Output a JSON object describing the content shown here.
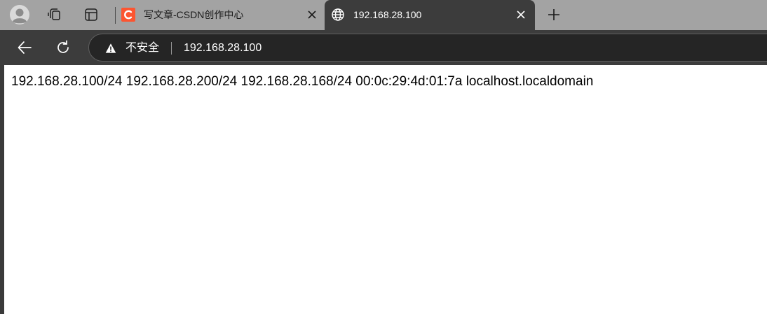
{
  "tabs": [
    {
      "title": "写文章-CSDN创作中心",
      "icon": "csdn-logo-icon",
      "active": false
    },
    {
      "title": "192.168.28.100",
      "icon": "globe-icon",
      "active": true
    }
  ],
  "address_bar": {
    "security_label": "不安全",
    "url": "192.168.28.100"
  },
  "page": {
    "text": "192.168.28.100/24 192.168.28.200/24 192.168.28.168/24 00:0c:29:4d:01:7a localhost.localdomain"
  },
  "colors": {
    "tabstrip": "#a3a3a3",
    "toolbar": "#3c3c3c",
    "omnibox": "#252525",
    "csdn_red": "#fc5531"
  }
}
